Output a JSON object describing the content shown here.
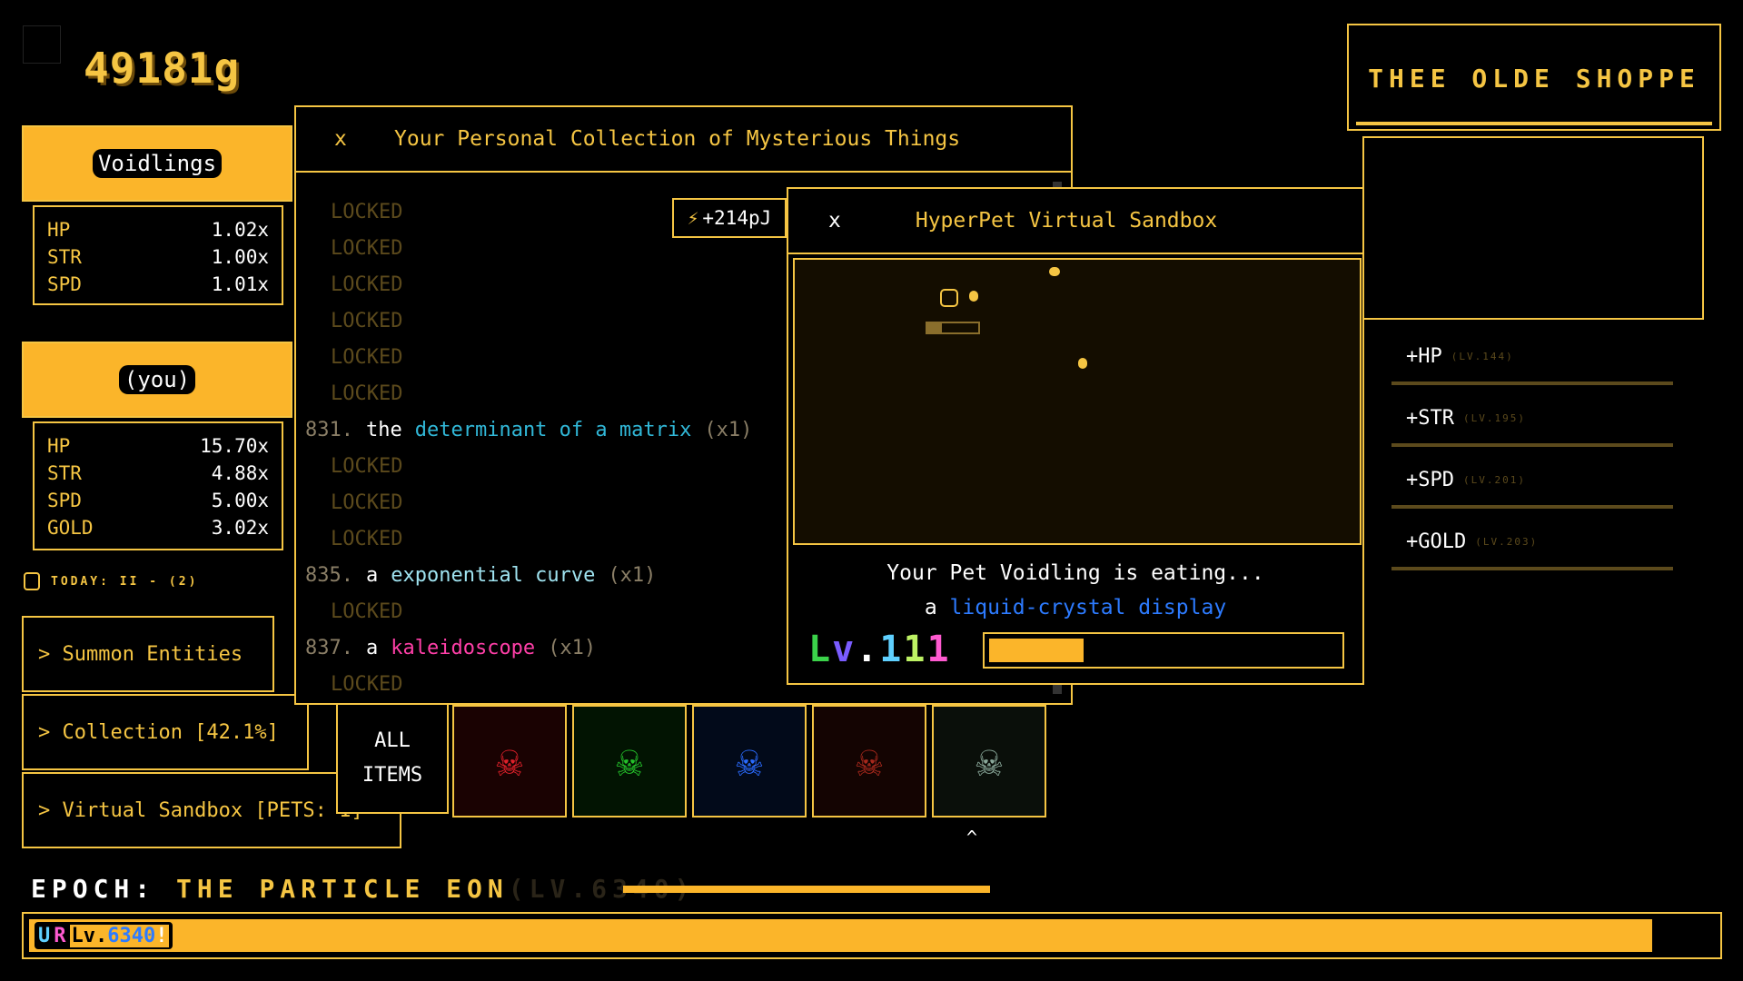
{
  "currency": {
    "gold": "49181g"
  },
  "voidlings": {
    "title": "Voidlings",
    "stats": [
      {
        "key": "HP",
        "value": "1.02x"
      },
      {
        "key": "STR",
        "value": "1.00x"
      },
      {
        "key": "SPD",
        "value": "1.01x"
      }
    ]
  },
  "player": {
    "title": "(you)",
    "stats": [
      {
        "key": "HP",
        "value": "15.70x"
      },
      {
        "key": "STR",
        "value": "4.88x"
      },
      {
        "key": "SPD",
        "value": "5.00x"
      },
      {
        "key": "GOLD",
        "value": "3.02x"
      }
    ]
  },
  "today": {
    "label": "TODAY: II - (2)"
  },
  "menu": {
    "summon": "> Summon Entities",
    "collection": "> Collection [42.1%]",
    "sandbox": "> Virtual Sandbox [PETS: 1]"
  },
  "collection_window": {
    "close": "x",
    "title": "Your Personal Collection of Mysterious Things",
    "locked_label": "LOCKED",
    "items": [
      {
        "locked": true
      },
      {
        "locked": true
      },
      {
        "locked": true
      },
      {
        "locked": true
      },
      {
        "locked": true
      },
      {
        "locked": true
      },
      {
        "locked": false,
        "number": "831.",
        "article": "the",
        "name": "determinant of a matrix",
        "count": "(x1)",
        "color": "#31b8d8"
      },
      {
        "locked": true
      },
      {
        "locked": true
      },
      {
        "locked": true
      },
      {
        "locked": false,
        "number": "835.",
        "article": "a",
        "name": "exponential curve",
        "count": "(x1)",
        "color": "#9fe3f0"
      },
      {
        "locked": true
      },
      {
        "locked": false,
        "number": "837.",
        "article": "a",
        "name": "kaleidoscope",
        "count": "(x1)",
        "color": "#ff3fa8"
      },
      {
        "locked": true
      }
    ]
  },
  "energy": {
    "icon": "lightning-icon",
    "value": "+214pJ"
  },
  "sandbox_window": {
    "close": "x",
    "title": "HyperPet Virtual Sandbox",
    "status_line": "Your Pet Voidling is eating...",
    "food_article": "a",
    "food_name": "liquid-crystal display",
    "food_color": "#2d7bff",
    "level_chars": [
      "L",
      "v",
      ".",
      "1",
      "1",
      "1"
    ],
    "level_colors": [
      "#3bd24a",
      "#7a5cff",
      "#ffffff",
      "#5fd0ff",
      "#bdf264",
      "#ff5ad0"
    ],
    "progress": 0.27
  },
  "inventory": {
    "all_line1": "ALL",
    "all_line2": "ITEMS",
    "tabs": [
      {
        "icon": "skull-icon",
        "color": "#e0202a",
        "bg": "#1a0202"
      },
      {
        "icon": "skull-icon",
        "color": "#24c22a",
        "bg": "#021402"
      },
      {
        "icon": "skull-icon",
        "color": "#2a6bff",
        "bg": "#020a1a"
      },
      {
        "icon": "skull-icon",
        "color": "#a8281c",
        "bg": "#140402"
      },
      {
        "icon": "skull-icon",
        "color": "#8aa89a",
        "bg": "#0a0f0a"
      }
    ],
    "caret": "^"
  },
  "shop": {
    "title": "THEE OLDE SHOPPE",
    "upgrades": [
      {
        "label": "+HP",
        "level": "(LV.144)"
      },
      {
        "label": "+STR",
        "level": "(LV.195)"
      },
      {
        "label": "+SPD",
        "level": "(LV.201)"
      },
      {
        "label": "+GOLD",
        "level": "(LV.203)"
      }
    ]
  },
  "epoch": {
    "label": "EPOCH:",
    "name": "THE PARTICLE EON",
    "level": "(LV.6340)",
    "tag_u": "U",
    "tag_r": "R",
    "tag_lv": "Lv.",
    "tag_num": "6340",
    "tag_bang": "!",
    "progress": 0.96
  },
  "colors": {
    "accent": "#fbb52a",
    "border": "#f5c543",
    "locked": "#5c4a1c"
  }
}
